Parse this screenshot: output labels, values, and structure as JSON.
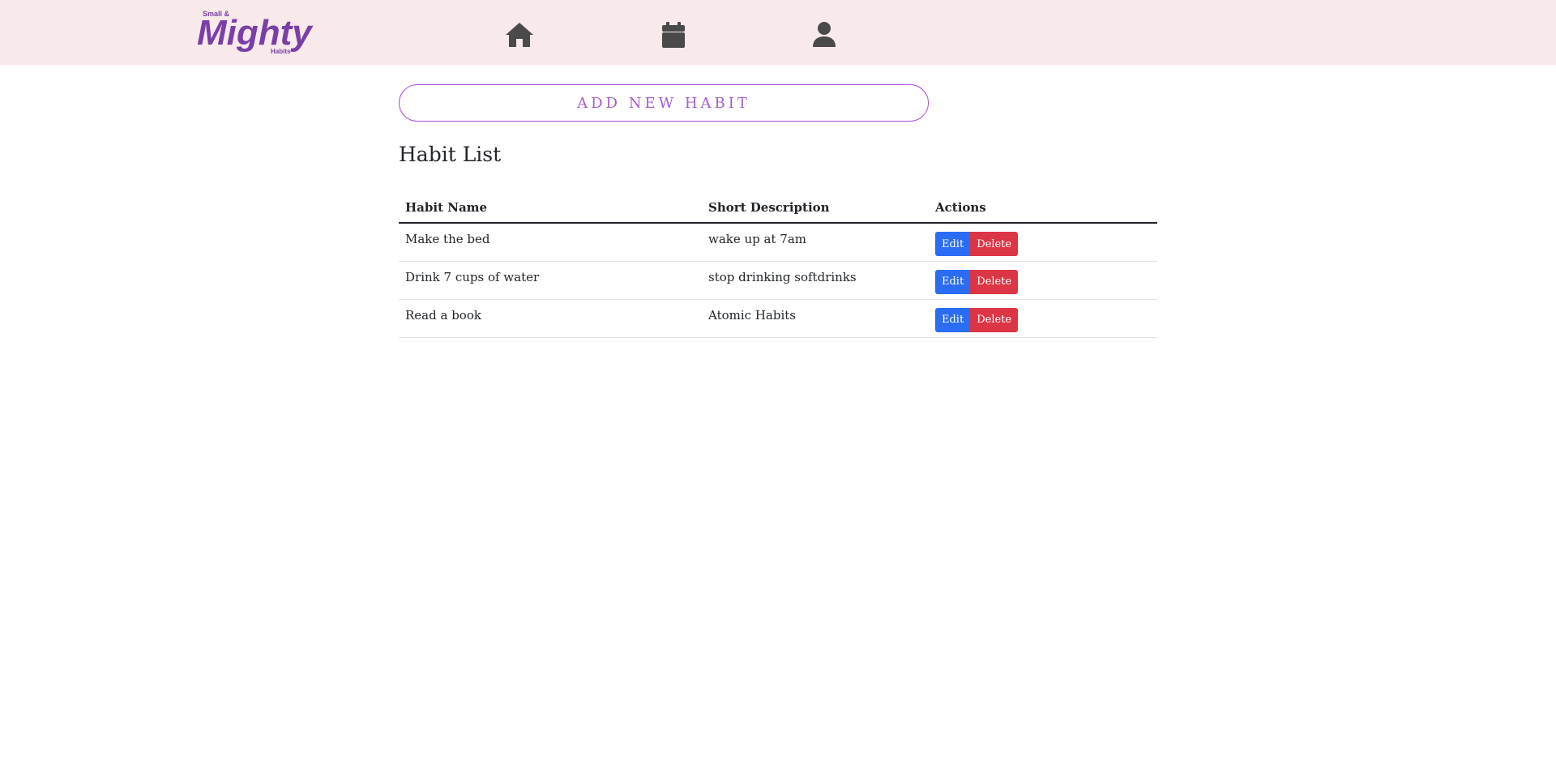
{
  "brand": {
    "small_text": "Small &",
    "main_text": "Mighty",
    "sub_text": "Habits",
    "color": "#7a3fa6"
  },
  "nav": {
    "items": [
      {
        "icon": "home-icon"
      },
      {
        "icon": "calendar-icon"
      },
      {
        "icon": "user-icon"
      }
    ]
  },
  "add_button_label": "ADD NEW HABIT",
  "page_title": "Habit List",
  "table": {
    "headers": [
      "Habit Name",
      "Short Description",
      "Actions"
    ],
    "rows": [
      {
        "name": "Make the bed",
        "description": "wake up at 7am"
      },
      {
        "name": "Drink 7 cups of water",
        "description": "stop drinking softdrinks"
      },
      {
        "name": "Read a book",
        "description": "Atomic Habits"
      }
    ],
    "edit_label": "Edit",
    "delete_label": "Delete"
  },
  "colors": {
    "navbar_bg": "#f8e9ea",
    "accent": "#a94fd0",
    "edit": "#2a6df4",
    "delete": "#dc3545",
    "icon": "#4a4a4a"
  }
}
